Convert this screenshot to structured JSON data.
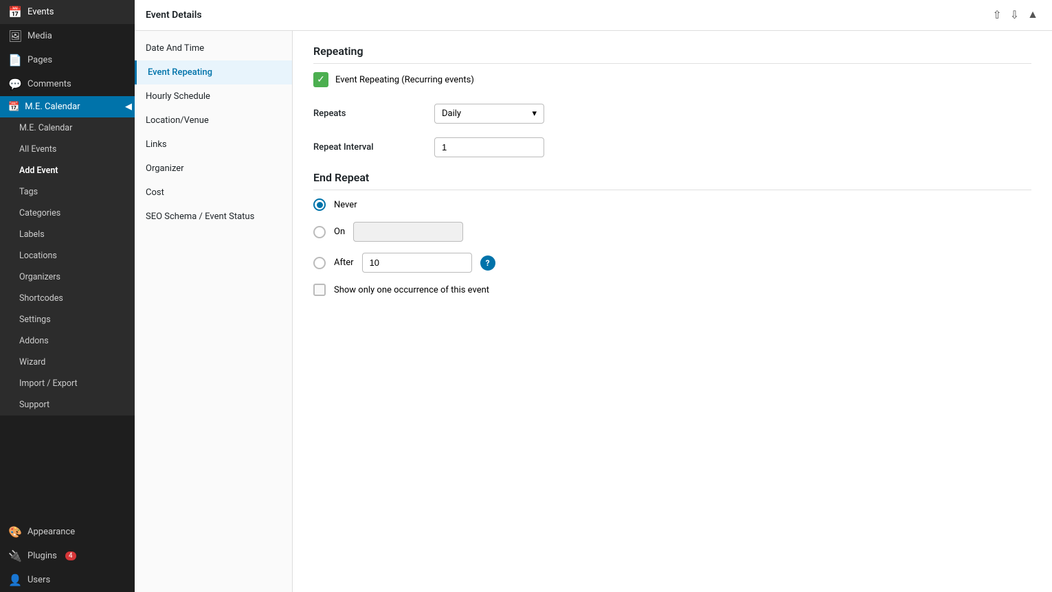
{
  "sidebar": {
    "items": [
      {
        "id": "events",
        "label": "Events",
        "icon": "📅"
      },
      {
        "id": "media",
        "label": "Media",
        "icon": "🖼"
      },
      {
        "id": "pages",
        "label": "Pages",
        "icon": "📄"
      },
      {
        "id": "comments",
        "label": "Comments",
        "icon": "💬"
      },
      {
        "id": "me-calendar",
        "label": "M.E. Calendar",
        "icon": "📆",
        "active": true
      }
    ],
    "submenu": [
      {
        "id": "me-calendar-sub",
        "label": "M.E. Calendar"
      },
      {
        "id": "all-events",
        "label": "All Events"
      },
      {
        "id": "add-event",
        "label": "Add Event",
        "active": true
      },
      {
        "id": "tags",
        "label": "Tags"
      },
      {
        "id": "categories",
        "label": "Categories"
      },
      {
        "id": "labels",
        "label": "Labels"
      },
      {
        "id": "locations",
        "label": "Locations"
      },
      {
        "id": "organizers",
        "label": "Organizers"
      },
      {
        "id": "shortcodes",
        "label": "Shortcodes"
      },
      {
        "id": "settings",
        "label": "Settings"
      },
      {
        "id": "addons",
        "label": "Addons"
      },
      {
        "id": "wizard",
        "label": "Wizard"
      },
      {
        "id": "import-export",
        "label": "Import / Export"
      },
      {
        "id": "support",
        "label": "Support"
      }
    ],
    "bottom_items": [
      {
        "id": "appearance",
        "label": "Appearance",
        "icon": "🎨"
      },
      {
        "id": "plugins",
        "label": "Plugins",
        "icon": "🔌",
        "badge": "4"
      },
      {
        "id": "users",
        "label": "Users",
        "icon": "👤"
      }
    ]
  },
  "panel": {
    "title": "Event Details",
    "controls": [
      "▲",
      "▼",
      "▲"
    ]
  },
  "nav_items": [
    {
      "id": "date-time",
      "label": "Date And Time"
    },
    {
      "id": "event-repeating",
      "label": "Event Repeating",
      "active": true
    },
    {
      "id": "hourly-schedule",
      "label": "Hourly Schedule"
    },
    {
      "id": "location-venue",
      "label": "Location/Venue"
    },
    {
      "id": "links",
      "label": "Links"
    },
    {
      "id": "organizer",
      "label": "Organizer"
    },
    {
      "id": "cost",
      "label": "Cost"
    },
    {
      "id": "seo-schema",
      "label": "SEO Schema / Event Status"
    }
  ],
  "content": {
    "repeating_section_title": "Repeating",
    "checkbox_label": "Event Repeating (Recurring events)",
    "repeats_label": "Repeats",
    "repeats_value": "Daily",
    "repeat_interval_label": "Repeat Interval",
    "repeat_interval_value": "1",
    "end_repeat_title": "End Repeat",
    "never_label": "Never",
    "on_label": "On",
    "after_label": "After",
    "after_value": "10",
    "show_one_label": "Show only one occurrence of this event",
    "help_text": "?"
  }
}
